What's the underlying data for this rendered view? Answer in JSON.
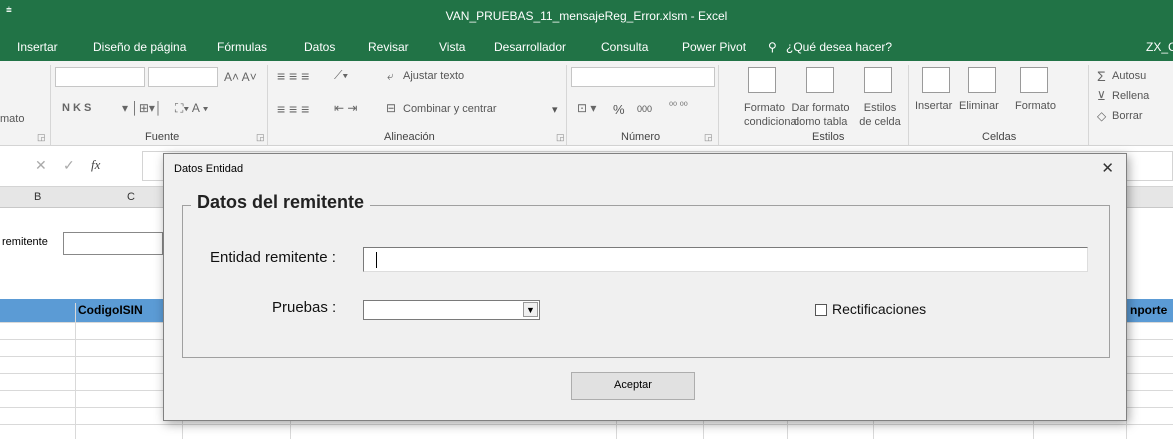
{
  "window": {
    "title": "VAN_PRUEBAS_11_mensajeReg_Error.xlsm - Excel",
    "quick_access": "⩧"
  },
  "ribbon_tabs": [
    {
      "label": "Insertar"
    },
    {
      "label": "Diseño de página"
    },
    {
      "label": "Fórmulas"
    },
    {
      "label": "Datos"
    },
    {
      "label": "Revisar"
    },
    {
      "label": "Vista"
    },
    {
      "label": "Desarrollador"
    },
    {
      "label": "Consulta"
    },
    {
      "label": "Power Pivot"
    },
    {
      "label": "¿Qué desea hacer?"
    },
    {
      "label": "ZX_C"
    }
  ],
  "ribbon": {
    "clipboard_partial": "mato",
    "font_group": "Fuente",
    "font_buttons": "N  K  S",
    "alignment_group": "Alineación",
    "wrap_text": "Ajustar texto",
    "merge_center": "Combinar y centrar",
    "number_group": "Número",
    "percent": "%",
    "thousands": "000",
    "styles_group": "Estilos",
    "conditional_format": "Formato condicional",
    "format_as_table": "Dar formato como tabla",
    "cell_styles": "Estilos de celda",
    "cells_group": "Celdas",
    "insert": "Insertar",
    "delete": "Eliminar",
    "format": "Formato",
    "autosum": "Autosu",
    "fill": "Rellena",
    "clear": "Borrar"
  },
  "formula_bar": {
    "fx": "fx"
  },
  "columns": [
    "B",
    "C"
  ],
  "sheet": {
    "label_remitente": "remitente",
    "header_isin": "CodigoISIN",
    "header_importe": "nporte"
  },
  "dialog": {
    "title": "Datos Entidad",
    "close": "✕",
    "frame_title": "Datos del remitente",
    "entity_label": "Entidad remitente :",
    "entity_value": "",
    "tests_label": "Pruebas :",
    "tests_value": "",
    "rectifications_label": "Rectificaciones",
    "rectifications_checked": false,
    "accept_label": "Aceptar"
  }
}
